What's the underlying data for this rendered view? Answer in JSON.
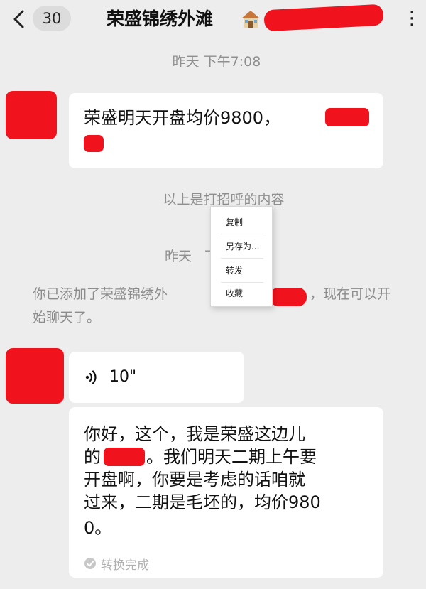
{
  "header": {
    "back_icon": "chevron-left-icon",
    "unread_count": "30",
    "title": "荣盛锦绣外滩",
    "title_icon": "house-icon",
    "more_icon": "more-dots-icon"
  },
  "chat": {
    "timestamp_1": "昨天 下午7:08",
    "message_1": "荣盛明天开盘均价9800，",
    "system_1": "以上是打招呼的内容",
    "timestamp_2": "昨天",
    "system_2_prefix": "你已添加了荣盛锦绣外",
    "system_2_suffix_line1": "，现在可以开",
    "system_2_line2": "始聊天了。",
    "voice_duration": "10\"",
    "voice_icon": "voice-wave-icon",
    "transcript_lines": [
      "你好，这个，我是荣盛这边儿",
      "。我们明天二期上午要",
      "开盘啊，你要是考虑的话咱就",
      "过来，二期是毛坯的，均价980",
      "0。"
    ],
    "transcript_line2_prefix": "的",
    "transcript_status": "转换完成",
    "transcript_status_icon": "check-circle-icon"
  },
  "context_menu": {
    "items": [
      "复制",
      "另存为...",
      "转发",
      "收藏"
    ]
  },
  "colors": {
    "background": "#ededed",
    "bubble": "#ffffff",
    "redaction": "#f0131d",
    "muted_text": "#8f8f8f"
  }
}
